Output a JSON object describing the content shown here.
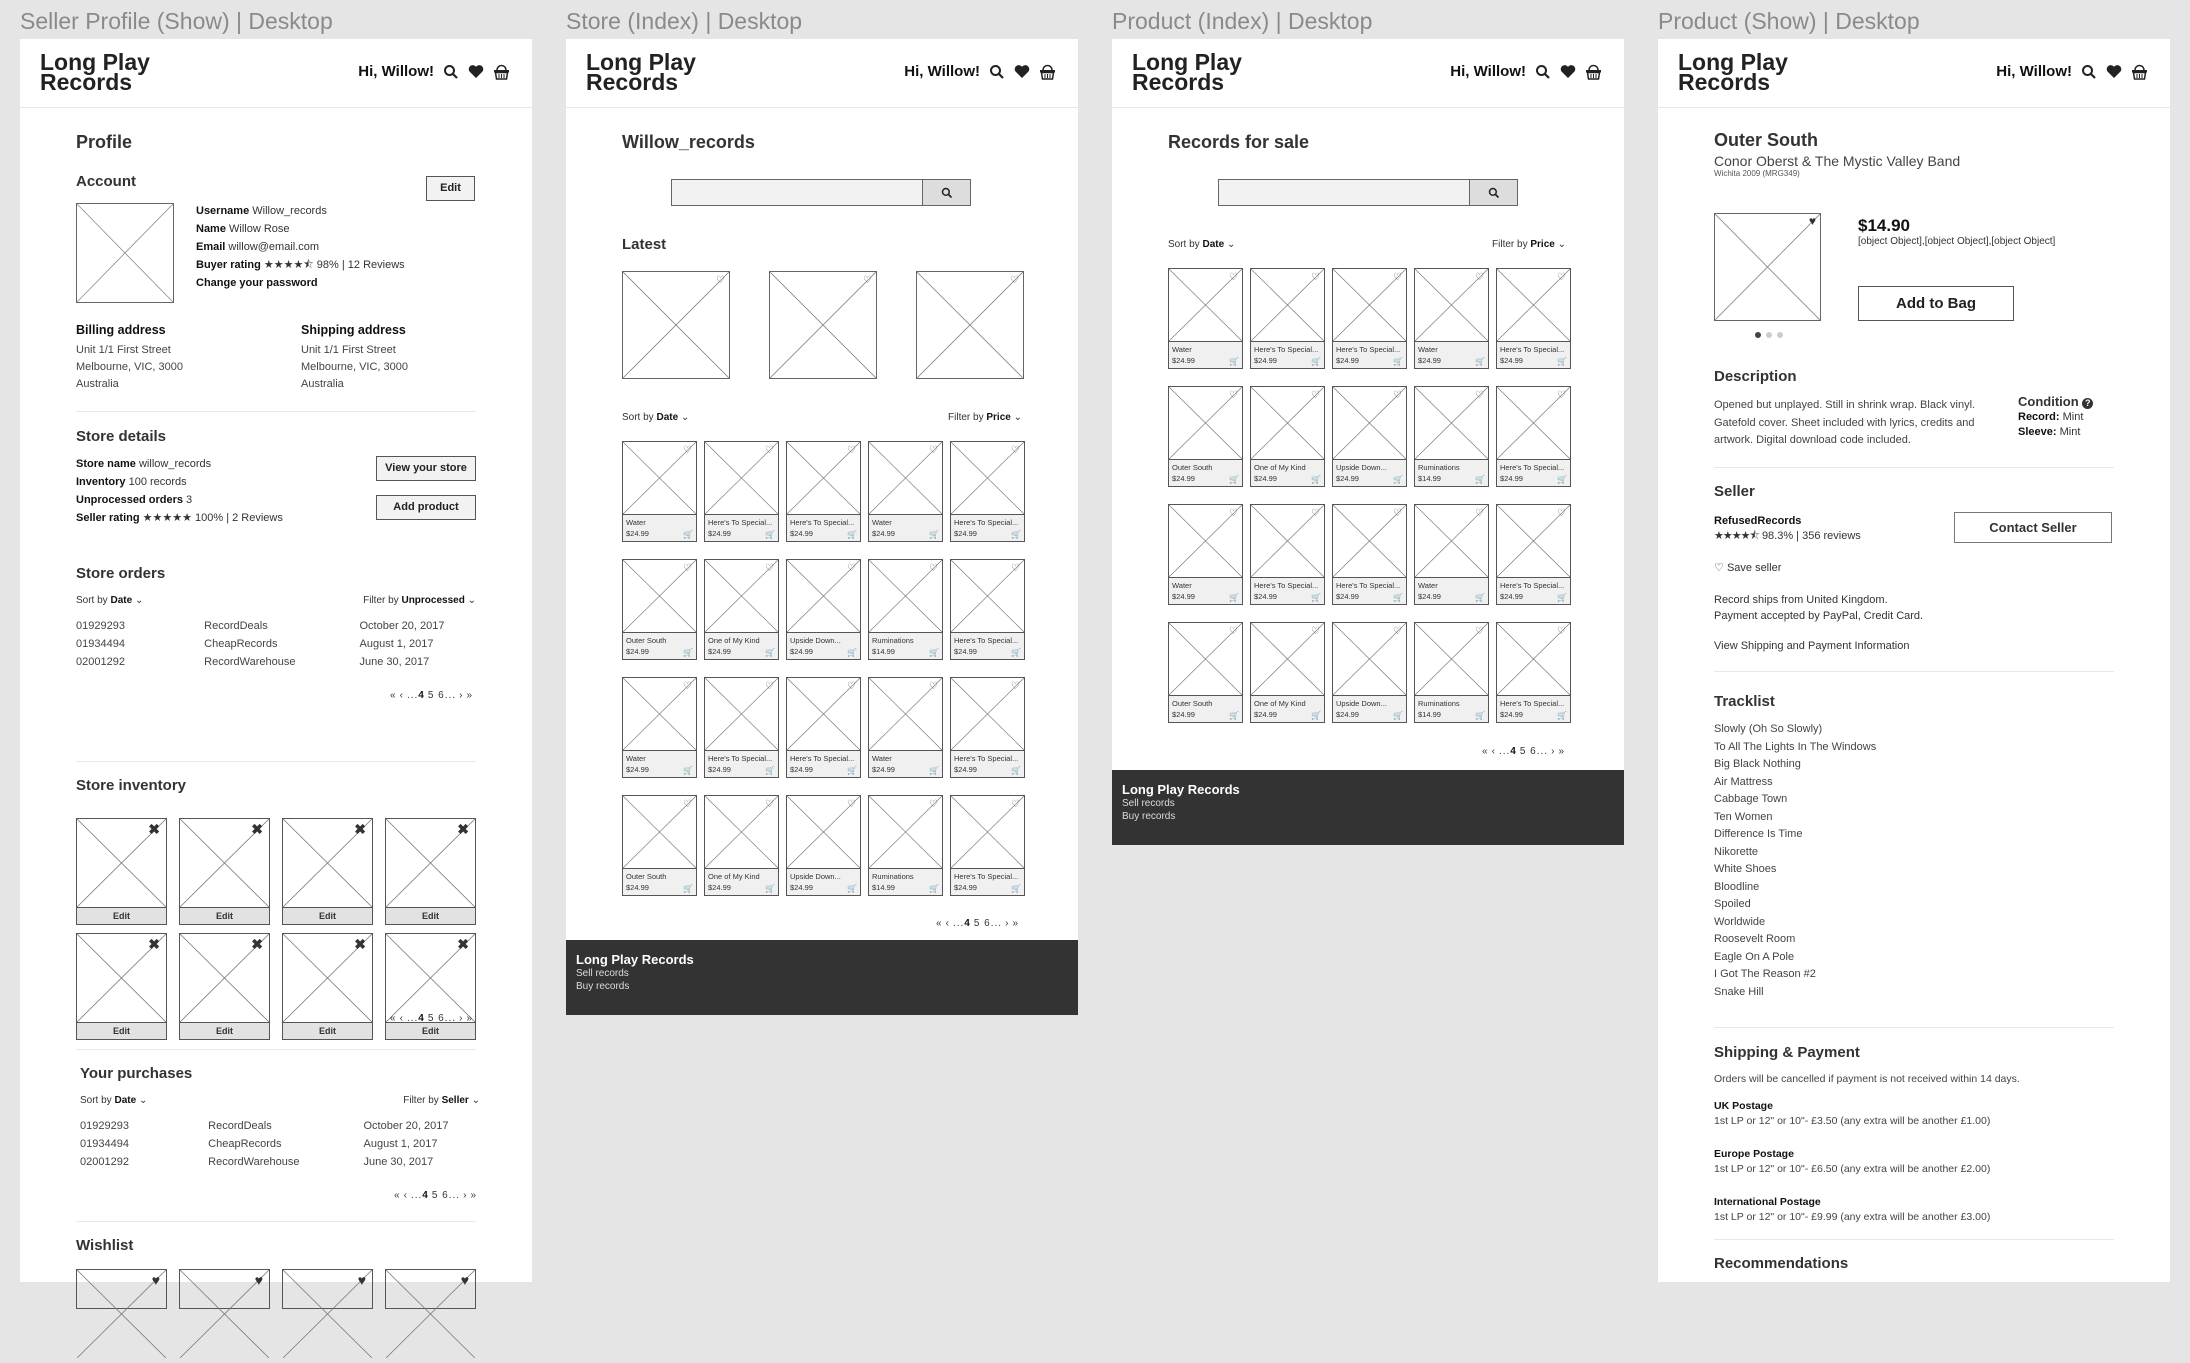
{
  "labels": [
    "Seller Profile (Show) | Desktop",
    "Store (Index) | Desktop",
    "Product (Index) | Desktop",
    "Product (Show) | Desktop"
  ],
  "header": {
    "logo_line1": "Long Play",
    "logo_line2": "Records",
    "greeting": "Hi, Willow!",
    "icons": [
      "search-icon",
      "heart-icon",
      "basket-icon"
    ]
  },
  "footer": {
    "title": "Long Play Records",
    "links": [
      "Sell records",
      "Buy records"
    ]
  },
  "pager": {
    "first": "«",
    "prev": "‹",
    "pages_before": "...",
    "current": "4",
    "next_pages": "5 6...",
    "next": "›",
    "last": "»"
  },
  "profile": {
    "title": "Profile",
    "account_title": "Account",
    "edit_label": "Edit",
    "fields": [
      {
        "label": "Username",
        "value": "Willow_records"
      },
      {
        "label": "Name",
        "value": "Willow Rose"
      },
      {
        "label": "Email",
        "value": "willow@email.com"
      }
    ],
    "buyer_rating_label": "Buyer rating",
    "buyer_rating_stars": 4.5,
    "buyer_rating_text": "98% | 12 Reviews",
    "change_password": "Change your password",
    "billing_title": "Billing address",
    "billing": [
      "Unit 1/1 First Street",
      "Melbourne, VIC, 3000",
      "Australia"
    ],
    "shipping_title": "Shipping address",
    "shipping": [
      "Unit 1/1 First Street",
      "Melbourne, VIC, 3000",
      "Australia"
    ],
    "store_title": "Store details",
    "store_fields": [
      {
        "label": "Store name",
        "value": "willow_records"
      },
      {
        "label": "Inventory",
        "value": "100 records"
      },
      {
        "label": "Unprocessed orders",
        "value": "3"
      }
    ],
    "seller_rating_label": "Seller rating",
    "seller_rating_stars": 5,
    "seller_rating_text": "100% | 2 Reviews",
    "view_store_label": "View your store",
    "add_product_label": "Add product",
    "orders_title": "Store orders",
    "orders_sort_label": "Sort by",
    "orders_sort_value": "Date",
    "orders_filter_label": "Filter by",
    "orders_filter_value": "Unprocessed",
    "orders": [
      {
        "id": "01929293",
        "seller": "RecordDeals",
        "date": "October 20, 2017"
      },
      {
        "id": "01934494",
        "seller": "CheapRecords",
        "date": "August 1, 2017"
      },
      {
        "id": "02001292",
        "seller": "RecordWarehouse",
        "date": "June 30, 2017"
      }
    ],
    "inventory_title": "Store inventory",
    "inventory_edit_label": "Edit",
    "inventory_count": 8,
    "purchases_title": "Your purchases",
    "purchases_sort_label": "Sort by",
    "purchases_sort_value": "Date",
    "purchases_filter_label": "Filter by",
    "purchases_filter_value": "Seller",
    "purchases": [
      {
        "id": "01929293",
        "seller": "RecordDeals",
        "date": "October 20, 2017"
      },
      {
        "id": "01934494",
        "seller": "CheapRecords",
        "date": "August 1, 2017"
      },
      {
        "id": "02001292",
        "seller": "RecordWarehouse",
        "date": "June 30, 2017"
      }
    ],
    "wishlist_title": "Wishlist"
  },
  "store": {
    "title": "Willow_records",
    "search_placeholder": "",
    "latest_title": "Latest",
    "sort_label": "Sort by",
    "sort_value": "Date",
    "filter_label": "Filter by",
    "filter_value": "Price"
  },
  "product_index": {
    "title": "Records for sale",
    "search_placeholder": "",
    "sort_label": "Sort by",
    "sort_value": "Date",
    "filter_label": "Filter by",
    "filter_value": "Price"
  },
  "products_row_a": [
    {
      "title": "Water",
      "price": "$24.99"
    },
    {
      "title": "Here's To Special...",
      "price": "$24.99"
    },
    {
      "title": "Here's To Special...",
      "price": "$24.99"
    },
    {
      "title": "Water",
      "price": "$24.99"
    },
    {
      "title": "Here's To Special...",
      "price": "$24.99"
    }
  ],
  "products_row_b": [
    {
      "title": "Outer South",
      "price": "$24.99"
    },
    {
      "title": "One of My Kind",
      "price": "$24.99"
    },
    {
      "title": "Upside Down...",
      "price": "$24.99"
    },
    {
      "title": "Ruminations",
      "price": "$14.99"
    },
    {
      "title": "Here's To Special...",
      "price": "$24.99"
    }
  ],
  "product": {
    "title": "Outer South",
    "artist": "Conor Oberst & The Mystic Valley Band",
    "meta": "Wichita  2009 (MRG349)",
    "price": "$14.90",
    "postage": [
      {
        "title": "UK Postage",
        "text": "1st LP or 12\" or 10\"- £3.50 (any extra will be another £1.00)"
      },
      {
        "title": "Europe Postage",
        "text": "1st LP or 12\" or 10\"- £6.50 (any extra will be another £2.00)"
      },
      {
        "title": "International Postage",
        "text": "1st LP or 12\" or 10\"- £9.99 (any extra will be another £3.00)"
      }
    ],
    "add_to_bag": "Add to Bag",
    "image_count": 3,
    "image_index": 1,
    "description_title": "Description",
    "description": "Opened but unplayed. Still in shrink wrap. Black vinyl. Gatefold cover. Sheet included with lyrics, credits and artwork. Digital download code included.",
    "condition_title": "Condition",
    "condition_record_label": "Record:",
    "condition_record": "Mint",
    "condition_sleeve_label": "Sleeve:",
    "condition_sleeve": "Mint",
    "seller_title": "Seller",
    "seller_name": "RefusedRecords",
    "seller_stars": 4.5,
    "seller_rating": "98.3% | 356 reviews",
    "contact_seller": "Contact Seller",
    "save_seller": "Save seller",
    "ships_from": "Record ships from United Kingdom.",
    "payment": "Payment accepted by PayPal, Credit Card.",
    "view_shipping": "View Shipping and Payment Information",
    "tracklist_title": "Tracklist",
    "tracklist": [
      "Slowly (Oh So Slowly)",
      "To All The Lights In The Windows",
      "Big Black Nothing",
      "Air Mattress",
      "Cabbage Town",
      "Ten Women",
      "Difference Is Time",
      "Nikorette",
      "White Shoes",
      "Bloodline",
      "Spoiled",
      "Worldwide",
      "Roosevelt Room",
      "Eagle On A Pole",
      "I Got The Reason #2",
      "Snake Hill"
    ],
    "shipping_title": "Shipping & Payment",
    "shipping_note": "Orders will be cancelled if payment is not received within 14 days.",
    "recommendations_title": "Recommendations"
  }
}
